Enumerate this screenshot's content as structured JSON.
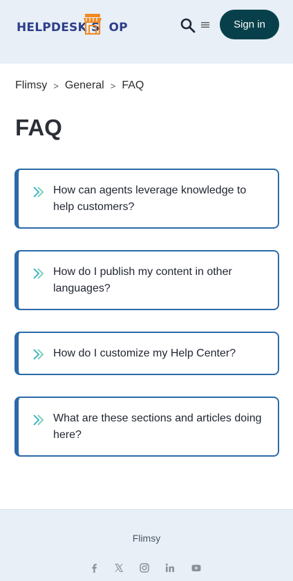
{
  "header": {
    "logo_text_a": "HELPDESK S",
    "logo_text_b": "OP",
    "signin_label": "Sign in"
  },
  "breadcrumb": {
    "items": [
      "Flimsy",
      "General",
      "FAQ"
    ],
    "separator": ">"
  },
  "page": {
    "title": "FAQ"
  },
  "faq": {
    "items": [
      {
        "question": "How can agents leverage knowledge to help customers?"
      },
      {
        "question": "How do I publish my content in other languages?"
      },
      {
        "question": "How do I customize my Help Center?"
      },
      {
        "question": "What are these sections and articles doing here?"
      }
    ]
  },
  "footer": {
    "brand": "Flimsy",
    "socials": [
      "facebook-icon",
      "x-icon",
      "instagram-icon",
      "linkedin-icon",
      "youtube-icon"
    ]
  },
  "colors": {
    "header_bg": "#e8eff6",
    "signin_bg": "#07404a",
    "card_border": "#2a6aa8",
    "logo_blue": "#2d3f8a",
    "logo_orange": "#f08a24",
    "arrow_teal": "#3fb7c4"
  }
}
